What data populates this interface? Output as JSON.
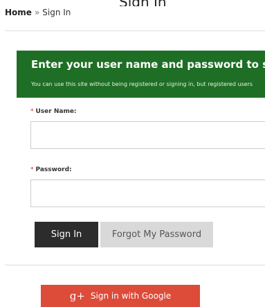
{
  "partial_heading": "Sign In",
  "breadcrumb": {
    "home": "Home",
    "separator": "»",
    "current": "Sign In"
  },
  "banner": {
    "title": "Enter your user name and password to sign in",
    "subtitle": "You can use this site without being registered or signing in, but registered users"
  },
  "form": {
    "required_marker": "*",
    "username_label": "User Name:",
    "username_value": "",
    "password_label": "Password:",
    "password_value": ""
  },
  "buttons": {
    "sign_in": "Sign In",
    "forgot_password": "Forgot My Password"
  },
  "google": {
    "icon_text": "g+",
    "label": "Sign in with Google"
  },
  "colors": {
    "banner": "#1f6e25",
    "primary_button": "#2c2c2c",
    "google": "#dd4b39",
    "required": "#d9241c"
  }
}
